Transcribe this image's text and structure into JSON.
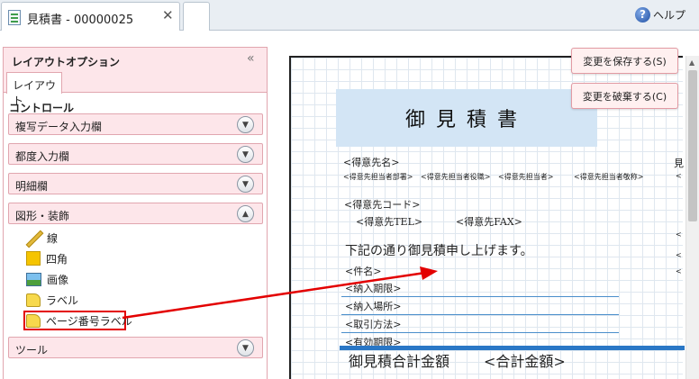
{
  "tab": {
    "title": "見積書 - 00000025",
    "close": "✕"
  },
  "help": {
    "icon": "help-icon",
    "label": "ヘルプ"
  },
  "panel": {
    "title": "レイアウトオプション",
    "collapse": "«",
    "subtab": "レイアウト",
    "controls_label": "コントロール",
    "sections": [
      {
        "label": "複写データ入力欄",
        "state": "collapsed"
      },
      {
        "label": "都度入力欄",
        "state": "collapsed"
      },
      {
        "label": "明細欄",
        "state": "collapsed"
      },
      {
        "label": "図形・装飾",
        "state": "expanded"
      },
      {
        "label": "ツール",
        "state": "collapsed"
      }
    ],
    "shape_items": [
      {
        "label": "線",
        "icon": "line-icon"
      },
      {
        "label": "四角",
        "icon": "rectangle-icon"
      },
      {
        "label": "画像",
        "icon": "image-icon"
      },
      {
        "label": "ラベル",
        "icon": "label-icon"
      },
      {
        "label": "ページ番号ラベル",
        "icon": "page-number-label-icon"
      }
    ]
  },
  "actions": {
    "save": "変更を保存する(S)",
    "discard": "変更を破棄する(C)"
  },
  "document": {
    "title": "御見積書",
    "customer_name": "<得意先名>",
    "customer_contacts": [
      "<得意先担当者部署>",
      "<得意先担当者役職>",
      "<得意先担当者>",
      "<得意先担当者敬称>"
    ],
    "customer_code": "<得意先コード>",
    "customer_tel": "<得意先TEL>",
    "customer_fax": "<得意先FAX>",
    "greeting": "下記の通り御見積申し上げます。",
    "fields": [
      "<件名>",
      "<納入期限>",
      "<納入場所>",
      "<取引方法>",
      "<有効期限>"
    ],
    "total_label": "御見積合計金額",
    "total_value": "<合計金額>",
    "right_edge_marks": [
      "見",
      "<",
      "<",
      "<",
      "<"
    ]
  },
  "colors": {
    "accent_pink": "#fde6ea",
    "highlight_red": "#e30000",
    "title_blue": "#d3e5f5"
  }
}
